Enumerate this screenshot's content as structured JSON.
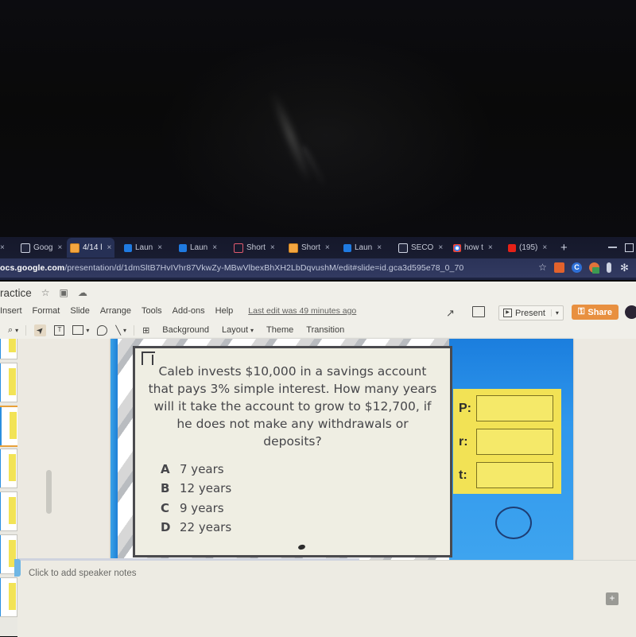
{
  "browser": {
    "tabs": [
      {
        "label": "",
        "favicon": "globe-icon",
        "active": false,
        "partial": true
      },
      {
        "label": "Goog",
        "favicon": "globe-icon",
        "active": false
      },
      {
        "label": "4/14 l",
        "favicon": "slides-icon",
        "active": true
      },
      {
        "label": "Laun",
        "favicon": "blue-square-icon",
        "active": false
      },
      {
        "label": "Laun",
        "favicon": "blue-square-icon",
        "active": false
      },
      {
        "label": "Short",
        "favicon": "red-ring-icon",
        "active": false
      },
      {
        "label": "Short",
        "favicon": "slides-icon",
        "active": false
      },
      {
        "label": "Laun",
        "favicon": "blue-square-icon",
        "active": false
      },
      {
        "label": "SECO",
        "favicon": "globe-icon",
        "active": false
      },
      {
        "label": "how t",
        "favicon": "google-icon",
        "active": false
      },
      {
        "label": "(195)",
        "favicon": "youtube-icon",
        "active": false
      }
    ],
    "new_tab_label": "+",
    "close_label": "×",
    "url_host": "ocs.google.com",
    "url_path": "/presentation/d/1dmSltB7HvIVhr87VkwZy-MBwVlbexBhXH2LbDqvushM/edit#slide=id.gca3d595e78_0_70",
    "star_glyph": "☆",
    "extension_c_label": "C",
    "extensions_glyph": "✻"
  },
  "app": {
    "doc_title": "ractice",
    "star_glyph": "☆",
    "move_glyph": "▣",
    "cloud_glyph": "☁",
    "menus": [
      "Insert",
      "Format",
      "Slide",
      "Arrange",
      "Tools",
      "Add-ons",
      "Help"
    ],
    "last_edit": "Last edit was 49 minutes ago",
    "present_label": "Present",
    "present_icon": "play-box-icon",
    "present_dropdown_glyph": "▾",
    "share_label": "Share",
    "share_lock_glyph": "⚿",
    "share_color": "#e89040",
    "trend_glyph": "↗",
    "toolbar": {
      "zoom_glyph": "⌕",
      "zoom_dropdown_glyph": "▾",
      "cursor_glyph": "➤",
      "textbox_glyph": "T",
      "image_dropdown_glyph": "▾",
      "line_glyph": "╲",
      "line_dropdown_glyph": "▾",
      "add_textbox_glyph": "⊞",
      "background_label": "Background",
      "layout_label": "Layout",
      "layout_dropdown_glyph": "▾",
      "theme_label": "Theme",
      "transition_label": "Transition"
    }
  },
  "slide": {
    "question": "Caleb invests $10,000 in a savings account that pays 3% simple interest. How many years will it take the account to grow to $12,700, if he does not make any withdrawals or deposits?",
    "choices": [
      {
        "letter": "A",
        "text": "7 years"
      },
      {
        "letter": "B",
        "text": "12 years"
      },
      {
        "letter": "C",
        "text": "9 years"
      },
      {
        "letter": "D",
        "text": "22 years"
      }
    ],
    "fields": [
      {
        "label": "P:",
        "value": ""
      },
      {
        "label": "r:",
        "value": ""
      },
      {
        "label": "t:",
        "value": ""
      }
    ],
    "accent_blue": "#1f85e8",
    "accent_yellow": "#f2e255",
    "question_bg": "#efeee3"
  },
  "notes": {
    "placeholder": "Click to add speaker notes",
    "plus_glyph": "+"
  }
}
